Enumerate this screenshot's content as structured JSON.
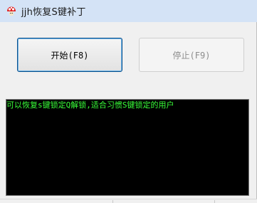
{
  "window": {
    "title": "jjh恢复S键补丁",
    "icon": "mushroom-icon"
  },
  "buttons": {
    "start_label": "开始(F8)",
    "stop_label": "停止(F9)"
  },
  "console": {
    "lines": [
      "可以恢复s键锁定Q解锁,适合习惯S键锁定的用户"
    ]
  },
  "colors": {
    "titlebar_bg": "#d4e3f6",
    "console_bg": "#000000",
    "console_text": "#39ff39",
    "disabled_text": "#8d8d8d"
  }
}
